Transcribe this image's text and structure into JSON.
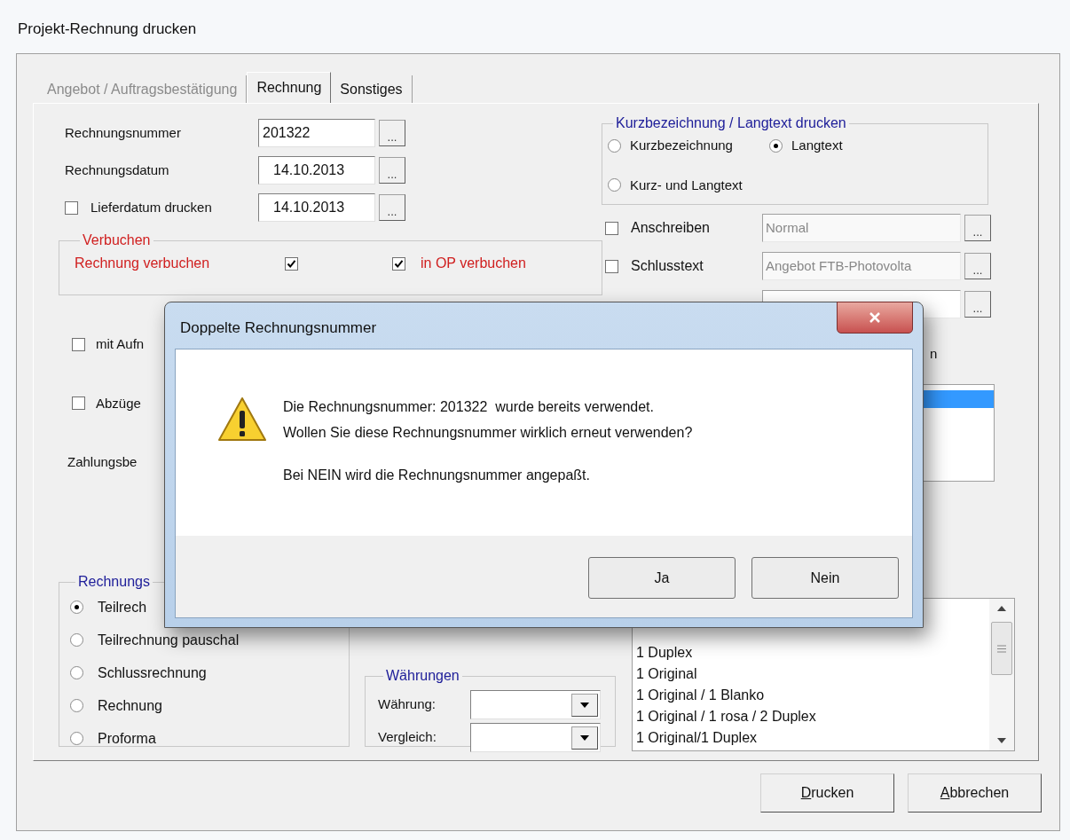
{
  "window": {
    "title": "Projekt-Rechnung drucken"
  },
  "tabs": [
    {
      "label": "Angebot / Auftragsbestätigung",
      "selected": false,
      "disabled": true
    },
    {
      "label": "Rechnung",
      "selected": true,
      "disabled": false
    },
    {
      "label": "Sonstiges",
      "selected": false,
      "disabled": false
    }
  ],
  "invoice_fields": [
    {
      "kind": "text",
      "label": "Rechnungsnummer",
      "value": "201322",
      "button": "..."
    },
    {
      "kind": "text",
      "label": "Rechnungsdatum",
      "value": "14.10.2013",
      "button": "..."
    },
    {
      "kind": "checkbox",
      "label": "Lieferdatum drucken",
      "checked": false,
      "value": "14.10.2013",
      "button": "..."
    }
  ],
  "booking": {
    "legend": "Verbuchen",
    "items": [
      {
        "kind": "label-first",
        "label": "Rechnung verbuchen",
        "checked": true
      },
      {
        "kind": "box-first",
        "label": "in OP verbuchen",
        "checked": true
      }
    ]
  },
  "options": [
    {
      "label": "mit Aufn",
      "checked": false
    },
    {
      "label": "Abzüge",
      "checked": false
    }
  ],
  "payment_label": "Zahlungsbe",
  "text_group": {
    "legend": "Kurzbezeichnung / Langtext drucken",
    "options": [
      {
        "label": "Kurzbezeichnung",
        "selected": false
      },
      {
        "label": "Langtext",
        "selected": true
      },
      {
        "label": "Kurz- und Langtext",
        "selected": false
      }
    ]
  },
  "attachments": [
    {
      "kind": "labeled",
      "label": "Anschreiben",
      "checked": false,
      "disabled": true,
      "value": "Normal",
      "button": "..."
    },
    {
      "kind": "labeled",
      "label": "Schlusstext",
      "checked": false,
      "disabled": true,
      "value": "Angebot FTB-Photovolta",
      "button": "..."
    },
    {
      "kind": "field-only",
      "button": "..."
    }
  ],
  "label_fragment": "n",
  "side_list": {
    "rows": [
      {
        "selected": true
      }
    ]
  },
  "invoice_type": {
    "legend": "Rechnungs",
    "options": [
      {
        "label": "Teilrech",
        "selected": true
      },
      {
        "label": "Teilrechnung pauschal",
        "selected": false
      },
      {
        "label": "Schlussrechnung",
        "selected": false
      },
      {
        "label": "Rechnung",
        "selected": false
      },
      {
        "label": "Proforma",
        "selected": false
      }
    ]
  },
  "currencies": {
    "legend": "Währungen",
    "fields": [
      {
        "label": "Währung:"
      },
      {
        "label": "Vergleich:"
      }
    ]
  },
  "copies_list": {
    "rows": [
      "1 Duplex",
      "1 Original",
      "1 Original / 1 Blanko",
      "1 Original / 1 rosa / 2 Duplex",
      "1 Original/1 Duplex"
    ]
  },
  "buttons": [
    {
      "mnemonic": "D",
      "label": "rucken"
    },
    {
      "mnemonic": "A",
      "label": "bbrechen"
    }
  ],
  "modal": {
    "title": "Doppelte Rechnungsnummer",
    "paragraphs": [
      [
        "Die Rechnungsnummer: 201322  wurde bereits verwendet.",
        "Wollen Sie diese Rechnungsnummer wirklich erneut verwenden?"
      ],
      [
        "Bei NEIN wird die Rechnungsnummer angepaßt."
      ]
    ],
    "buttons": [
      "Ja",
      "Nein"
    ]
  }
}
